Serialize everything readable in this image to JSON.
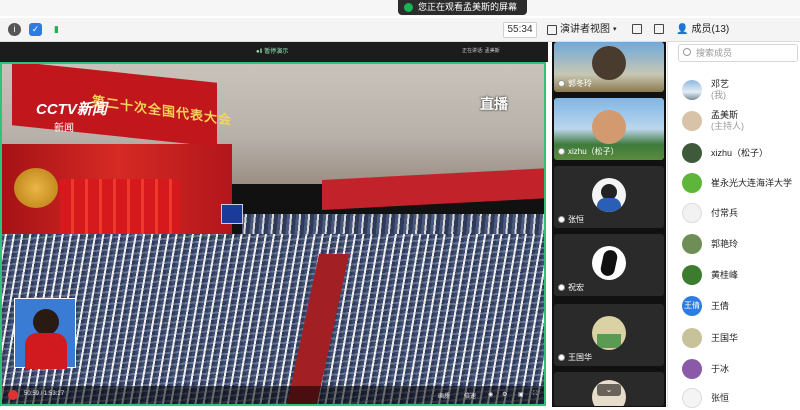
{
  "notification": {
    "text": "您正在观看孟美斯的屏幕",
    "accent": "#17b556"
  },
  "toolbar": {
    "info_icon": "info-icon",
    "shield_icon": "shield-icon",
    "signal_icon": "signal-icon",
    "timer": "55:34",
    "view_mode_label": "演讲者视图",
    "members_label": "成员(13)"
  },
  "shared_screen": {
    "top_label": "●Ⅱ 暂停演示",
    "right_label": "正在讲话: 孟美斯",
    "logo": "CCTV新闻",
    "logo_sub": "新闻",
    "banner": "第二十次全国代表大会",
    "live_badge": "直播",
    "time": "50:59 / 1:53:27",
    "controls": [
      "画质",
      "倍速"
    ]
  },
  "participants": [
    {
      "name": "郭冬玲"
    },
    {
      "name": "xizhu（松子）"
    },
    {
      "name": "张恒"
    },
    {
      "name": "祝宏"
    },
    {
      "name": "王国华"
    }
  ],
  "member_panel": {
    "search_placeholder": "搜索成员",
    "members": [
      {
        "name": "邓艺",
        "sub": "(我)"
      },
      {
        "name": "孟美斯",
        "sub": "(主持人)"
      },
      {
        "name": "xizhu（松子）",
        "sub": ""
      },
      {
        "name": "崔永光大连海洋大学",
        "sub": ""
      },
      {
        "name": "付常兵",
        "sub": ""
      },
      {
        "name": "郭艳玲",
        "sub": ""
      },
      {
        "name": "黄桂峰",
        "sub": ""
      },
      {
        "name": "王倩",
        "sub": ""
      },
      {
        "name": "王国华",
        "sub": ""
      },
      {
        "name": "于冰",
        "sub": ""
      },
      {
        "name": "张恒",
        "sub": ""
      }
    ]
  },
  "colors": {
    "active_border": "#2fc27b",
    "banner_red": "#c0161c"
  }
}
